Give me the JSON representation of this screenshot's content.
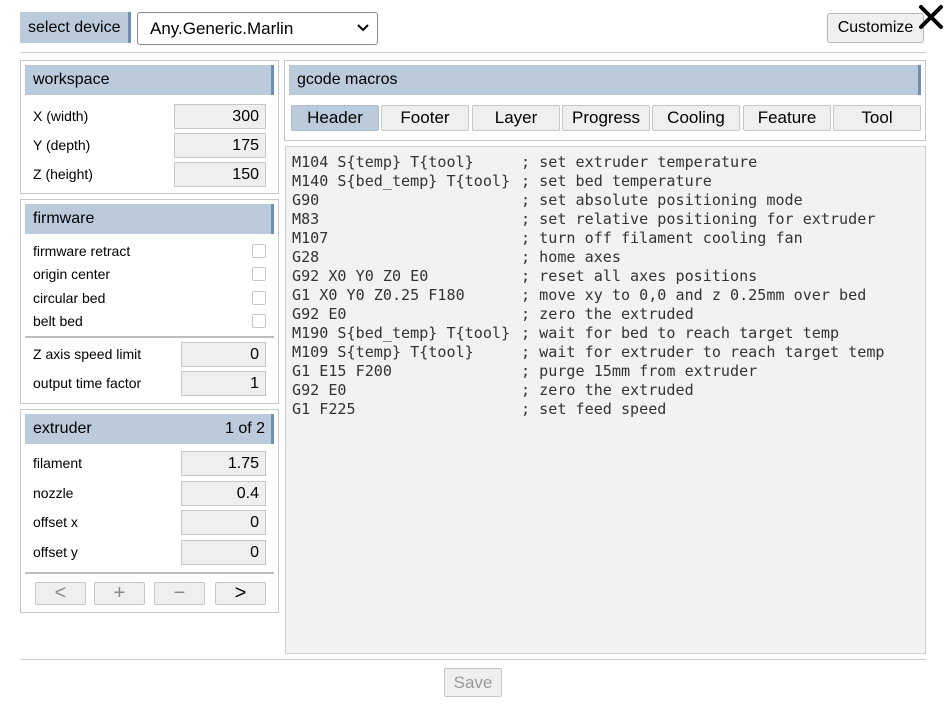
{
  "topbar": {
    "select_label": "select device",
    "device_value": "Any.Generic.Marlin",
    "customize_label": "Customize"
  },
  "workspace": {
    "title": "workspace",
    "rows": [
      {
        "label": "X (width)",
        "value": "300"
      },
      {
        "label": "Y (depth)",
        "value": "175"
      },
      {
        "label": "Z (height)",
        "value": "150"
      }
    ]
  },
  "firmware": {
    "title": "firmware",
    "checks": [
      {
        "label": "firmware retract",
        "checked": false
      },
      {
        "label": "origin center",
        "checked": false
      },
      {
        "label": "circular bed",
        "checked": false
      },
      {
        "label": "belt bed",
        "checked": false
      }
    ],
    "rows": [
      {
        "label": "Z axis speed limit",
        "value": "0"
      },
      {
        "label": "output time factor",
        "value": "1"
      }
    ]
  },
  "extruder": {
    "title": "extruder",
    "counter": "1 of 2",
    "rows": [
      {
        "label": "filament",
        "value": "1.75"
      },
      {
        "label": "nozzle",
        "value": "0.4"
      },
      {
        "label": "offset x",
        "value": "0"
      },
      {
        "label": "offset y",
        "value": "0"
      }
    ],
    "nav": {
      "prev": "<",
      "add": "+",
      "remove": "−",
      "next": ">"
    }
  },
  "macros": {
    "title": "gcode macros",
    "tabs": [
      "Header",
      "Footer",
      "Layer",
      "Progress",
      "Cooling",
      "Feature",
      "Tool"
    ],
    "active_tab": "Header",
    "lines": [
      {
        "cmd": "M104 S{temp} T{tool}",
        "comment": "; set extruder temperature"
      },
      {
        "cmd": "M140 S{bed_temp} T{tool}",
        "comment": "; set bed temperature"
      },
      {
        "cmd": "G90",
        "comment": "; set absolute positioning mode"
      },
      {
        "cmd": "M83",
        "comment": "; set relative positioning for extruder"
      },
      {
        "cmd": "M107",
        "comment": "; turn off filament cooling fan"
      },
      {
        "cmd": "G28",
        "comment": "; home axes"
      },
      {
        "cmd": "G92 X0 Y0 Z0 E0",
        "comment": "; reset all axes positions"
      },
      {
        "cmd": "G1 X0 Y0 Z0.25 F180",
        "comment": "; move xy to 0,0 and z 0.25mm over bed"
      },
      {
        "cmd": "G92 E0",
        "comment": "; zero the extruded"
      },
      {
        "cmd": "M190 S{bed_temp} T{tool}",
        "comment": "; wait for bed to reach target temp"
      },
      {
        "cmd": "M109 S{temp} T{tool}",
        "comment": "; wait for extruder to reach target temp"
      },
      {
        "cmd": "G1 E15 F200",
        "comment": "; purge 15mm from extruder"
      },
      {
        "cmd": "G92 E0",
        "comment": "; zero the extruded"
      },
      {
        "cmd": "G1 F225",
        "comment": "; set feed speed"
      }
    ]
  },
  "footer": {
    "save_label": "Save"
  },
  "colors": {
    "header_bg": "#bccbdc",
    "header_accent": "#6f8fb0",
    "field_bg": "#efefef"
  }
}
